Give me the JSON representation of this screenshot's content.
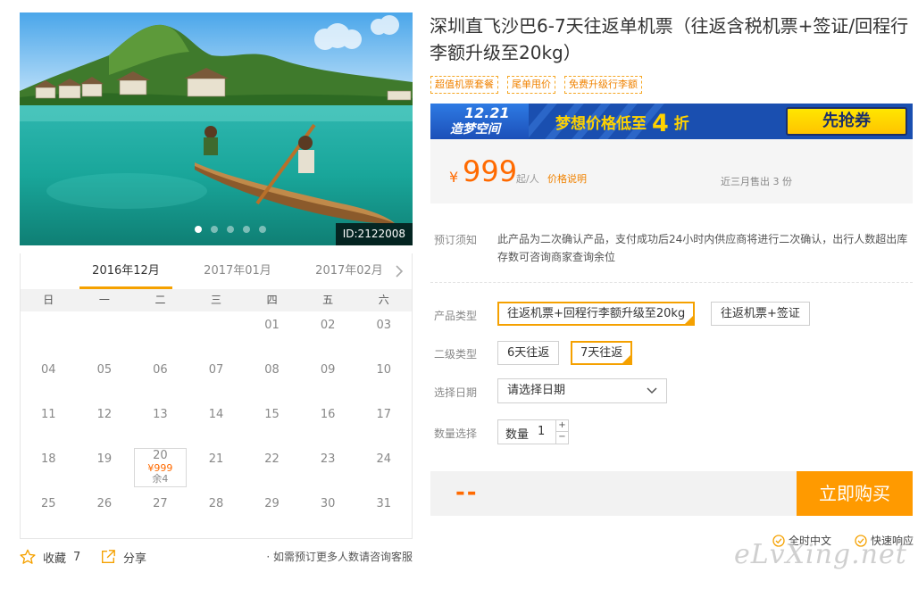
{
  "hero": {
    "id_label": "ID:2122008",
    "slide_count": 5,
    "active_slide": 0
  },
  "calendar": {
    "months": [
      "2016年12月",
      "2017年01月",
      "2017年02月"
    ],
    "active_month": 0,
    "weekdays": [
      "日",
      "一",
      "二",
      "三",
      "四",
      "五",
      "六"
    ],
    "lead_blanks": 4,
    "days": [
      "01",
      "02",
      "03",
      "04",
      "05",
      "06",
      "07",
      "08",
      "09",
      "10",
      "11",
      "12",
      "13",
      "14",
      "15",
      "16",
      "17",
      "18",
      "19",
      "20",
      "21",
      "22",
      "23",
      "24",
      "25",
      "26",
      "27",
      "28",
      "29",
      "30",
      "31"
    ],
    "special": {
      "day": "20",
      "price": "¥999",
      "remaining": "余4"
    }
  },
  "actions": {
    "favorite_label": "收藏",
    "favorite_count": "7",
    "share_label": "分享",
    "note": "· 如需预订更多人数请咨询客服"
  },
  "product": {
    "title": "深圳直飞沙巴6-7天往返单机票（往返含税机票+签证/回程行李额升级至20kg）",
    "tags": [
      "超值机票套餐",
      "尾单甩价",
      "免费升级行李额"
    ]
  },
  "banner": {
    "logo_top": "12.21",
    "logo_bottom": "造梦空间",
    "slogan_prefix": "梦想价格低至",
    "slogan_number": "4",
    "slogan_suffix": "折",
    "button": "先抢券",
    "colors": {
      "background": "#1a4fb0",
      "accent": "#ffd200"
    }
  },
  "price": {
    "currency": "¥",
    "value": "999",
    "unit": "起/人",
    "explain_link": "价格说明",
    "sold": "近三月售出 3 份"
  },
  "booking": {
    "notice_label": "预订须知",
    "notice_text": "此产品为二次确认产品，支付成功后24小时内供应商将进行二次确认，出行人数超出库存数可咨询商家查询余位",
    "type_label": "产品类型",
    "type_options": [
      "往返机票+回程行李额升级至20kg",
      "往返机票+签证"
    ],
    "type_selected": 0,
    "sub_label": "二级类型",
    "sub_options": [
      "6天往返",
      "7天往返"
    ],
    "sub_selected": 1,
    "date_label": "选择日期",
    "date_placeholder": "请选择日期",
    "qty_label": "数量选择",
    "qty_field_label": "数量",
    "qty_value": "1",
    "qty_plus": "+",
    "qty_minus": "−"
  },
  "buy": {
    "total": "--",
    "button": "立即购买",
    "accent_color": "#ff9a00"
  },
  "services": [
    "全时中文",
    "快速响应"
  ],
  "watermark": "eLvXing.net"
}
